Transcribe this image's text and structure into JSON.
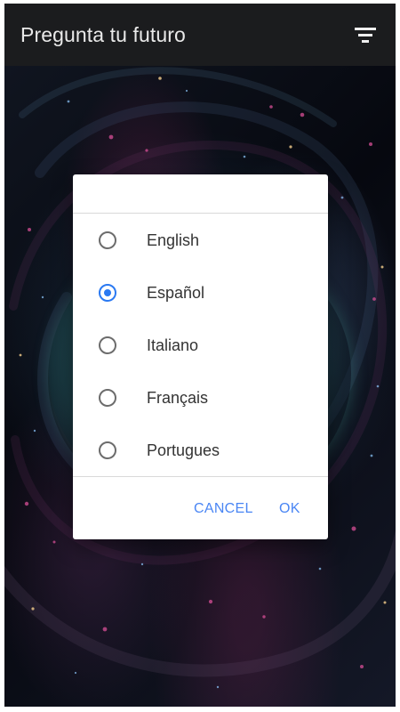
{
  "app_bar": {
    "title": "Pregunta tu futuro",
    "filter_icon": "filter-icon"
  },
  "dialog": {
    "options": [
      {
        "label": "English",
        "selected": false
      },
      {
        "label": "Español",
        "selected": true
      },
      {
        "label": "Italiano",
        "selected": false
      },
      {
        "label": "Français",
        "selected": false
      },
      {
        "label": "Portugues",
        "selected": false
      }
    ],
    "actions": {
      "cancel": "CANCEL",
      "ok": "OK"
    }
  },
  "colors": {
    "app_bar": "#1b1c1e",
    "dialog_accent": "#2a79f2",
    "button_text": "#4a86f4"
  }
}
